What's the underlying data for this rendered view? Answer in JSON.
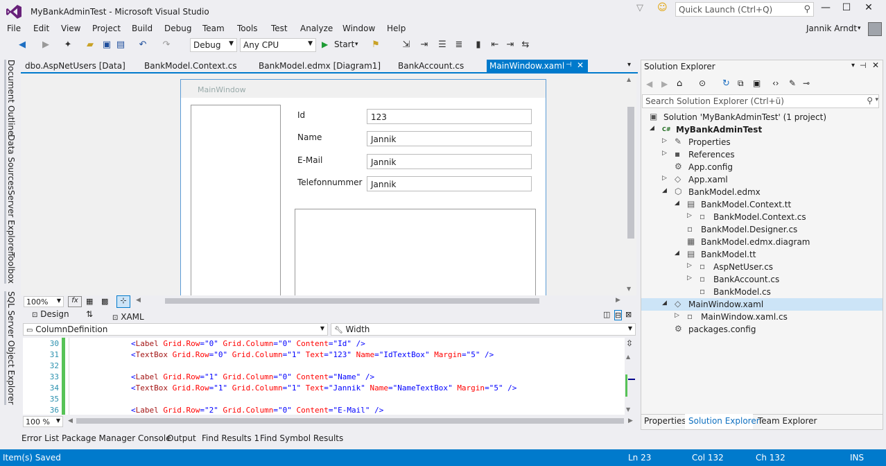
{
  "titlebar": {
    "title": "MyBankAdminTest - Microsoft Visual Studio",
    "quick_launch_placeholder": "Quick Launch (Ctrl+Q)"
  },
  "menu": [
    "File",
    "Edit",
    "View",
    "Project",
    "Build",
    "Debug",
    "Team",
    "Tools",
    "Test",
    "Analyze",
    "Window",
    "Help"
  ],
  "user": {
    "name": "Jannik Arndt"
  },
  "toolbar": {
    "config": "Debug",
    "platform": "Any CPU",
    "start_label": "Start"
  },
  "left_rail": [
    "Document Outline",
    "Data Sources",
    "Server Explorer",
    "Toolbox",
    "SQL Server Object Explorer"
  ],
  "doc_tabs": [
    "dbo.AspNetUsers [Data]",
    "BankModel.Context.cs",
    "BankModel.edmx [Diagram1]",
    "BankAccount.cs"
  ],
  "active_tab": "MainWindow.xaml",
  "designer": {
    "window_title": "MainWindow",
    "labels": [
      "Id",
      "Name",
      "E-Mail",
      "Telefonnummer"
    ],
    "values": [
      "123",
      "Jannik",
      "Jannik",
      "Jannik"
    ],
    "zoom": "100%"
  },
  "split_tabs": {
    "design": "Design",
    "xaml": "XAML"
  },
  "prop_bar": {
    "element": "ColumnDefinition",
    "property": "Width"
  },
  "editor": {
    "zoom": "100 %",
    "lines": [
      {
        "n": "30",
        "tag": "Label",
        "attrs": [
          [
            "Grid.Row",
            "0"
          ],
          [
            "Grid.Column",
            "0"
          ],
          [
            "Content",
            "Id"
          ]
        ],
        "end": " />"
      },
      {
        "n": "31",
        "tag": "TextBox",
        "attrs": [
          [
            "Grid.Row",
            "0"
          ],
          [
            "Grid.Column",
            "1"
          ],
          [
            "Text",
            "123"
          ],
          [
            "Name",
            "IdTextBox"
          ],
          [
            "Margin",
            "5"
          ]
        ],
        "end": " />"
      },
      {
        "n": "32",
        "tag": "",
        "attrs": [],
        "end": ""
      },
      {
        "n": "33",
        "tag": "Label",
        "attrs": [
          [
            "Grid.Row",
            "1"
          ],
          [
            "Grid.Column",
            "0"
          ],
          [
            "Content",
            "Name"
          ]
        ],
        "end": " />"
      },
      {
        "n": "34",
        "tag": "TextBox",
        "attrs": [
          [
            "Grid.Row",
            "1"
          ],
          [
            "Grid.Column",
            "1"
          ],
          [
            "Text",
            "Jannik"
          ],
          [
            "Name",
            "NameTextBox"
          ],
          [
            "Margin",
            "5"
          ]
        ],
        "end": " />"
      },
      {
        "n": "35",
        "tag": "",
        "attrs": [],
        "end": ""
      },
      {
        "n": "36",
        "tag": "Label",
        "attrs": [
          [
            "Grid.Row",
            "2"
          ],
          [
            "Grid.Column",
            "0"
          ],
          [
            "Content",
            "E-Mail"
          ]
        ],
        "end": " />"
      }
    ]
  },
  "solution_explorer": {
    "title": "Solution Explorer",
    "search_placeholder": "Search Solution Explorer (Ctrl+ü)",
    "items": [
      {
        "label": "Solution 'MyBankAdminTest' (1 project)",
        "level": 0,
        "arrow": "",
        "icon": "solution-icon",
        "bold": false
      },
      {
        "label": "MyBankAdminTest",
        "level": 0,
        "arrow": "open",
        "icon": "csharp-project-icon",
        "bold": true
      },
      {
        "label": "Properties",
        "level": 1,
        "arrow": "closed",
        "icon": "wrench-icon",
        "bold": false
      },
      {
        "label": "References",
        "level": 1,
        "arrow": "closed",
        "icon": "references-icon",
        "bold": false
      },
      {
        "label": "App.config",
        "level": 1,
        "arrow": "",
        "icon": "config-file-icon",
        "bold": false
      },
      {
        "label": "App.xaml",
        "level": 1,
        "arrow": "closed",
        "icon": "xaml-file-icon",
        "bold": false
      },
      {
        "label": "BankModel.edmx",
        "level": 1,
        "arrow": "open",
        "icon": "edmx-icon",
        "bold": false
      },
      {
        "label": "BankModel.Context.tt",
        "level": 2,
        "arrow": "open",
        "icon": "tt-file-icon",
        "bold": false
      },
      {
        "label": "BankModel.Context.cs",
        "level": 3,
        "arrow": "closed",
        "icon": "cs-file-icon",
        "bold": false
      },
      {
        "label": "BankModel.Designer.cs",
        "level": 2,
        "arrow": "",
        "icon": "cs-file-icon",
        "bold": false
      },
      {
        "label": "BankModel.edmx.diagram",
        "level": 2,
        "arrow": "",
        "icon": "diagram-file-icon",
        "bold": false
      },
      {
        "label": "BankModel.tt",
        "level": 2,
        "arrow": "open",
        "icon": "tt-file-icon",
        "bold": false
      },
      {
        "label": "AspNetUser.cs",
        "level": 3,
        "arrow": "closed",
        "icon": "cs-file-icon",
        "bold": false
      },
      {
        "label": "BankAccount.cs",
        "level": 3,
        "arrow": "closed",
        "icon": "cs-file-icon",
        "bold": false
      },
      {
        "label": "BankModel.cs",
        "level": 3,
        "arrow": "",
        "icon": "cs-file-icon",
        "bold": false
      },
      {
        "label": "MainWindow.xaml",
        "level": 1,
        "arrow": "open",
        "icon": "xaml-file-icon",
        "bold": false,
        "selected": true
      },
      {
        "label": "MainWindow.xaml.cs",
        "level": 2,
        "arrow": "closed",
        "icon": "cs-file-icon",
        "bold": false
      },
      {
        "label": "packages.config",
        "level": 1,
        "arrow": "",
        "icon": "config-file-icon",
        "bold": false
      }
    ],
    "tabs": [
      "Properties",
      "Solution Explorer",
      "Team Explorer"
    ]
  },
  "bottom_tabs": [
    "Error List",
    "Package Manager Console",
    "Output",
    "Find Results 1",
    "Find Symbol Results"
  ],
  "status": {
    "message": "Item(s) Saved",
    "ln": "Ln 23",
    "col": "Col 132",
    "ch": "Ch 132",
    "mode": "INS"
  }
}
